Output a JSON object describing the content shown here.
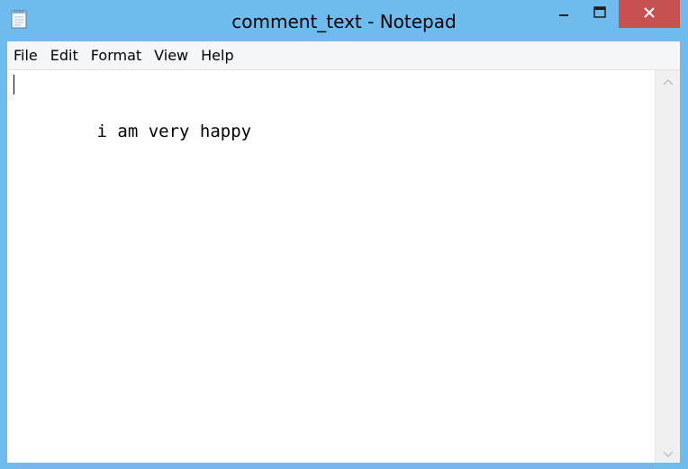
{
  "window": {
    "title": "comment_text - Notepad",
    "icon": "notepad-icon",
    "controls": {
      "minimize": "minimize-icon",
      "maximize": "maximize-icon",
      "close": "close-icon"
    },
    "colors": {
      "frame": "#6ebcee",
      "close_button": "#c75050"
    }
  },
  "menu": {
    "items": [
      "File",
      "Edit",
      "Format",
      "View",
      "Help"
    ]
  },
  "editor": {
    "content": "i am very happy"
  },
  "scrollbar": {
    "up_icon": "chevron-up-icon",
    "down_icon": "chevron-down-icon"
  }
}
